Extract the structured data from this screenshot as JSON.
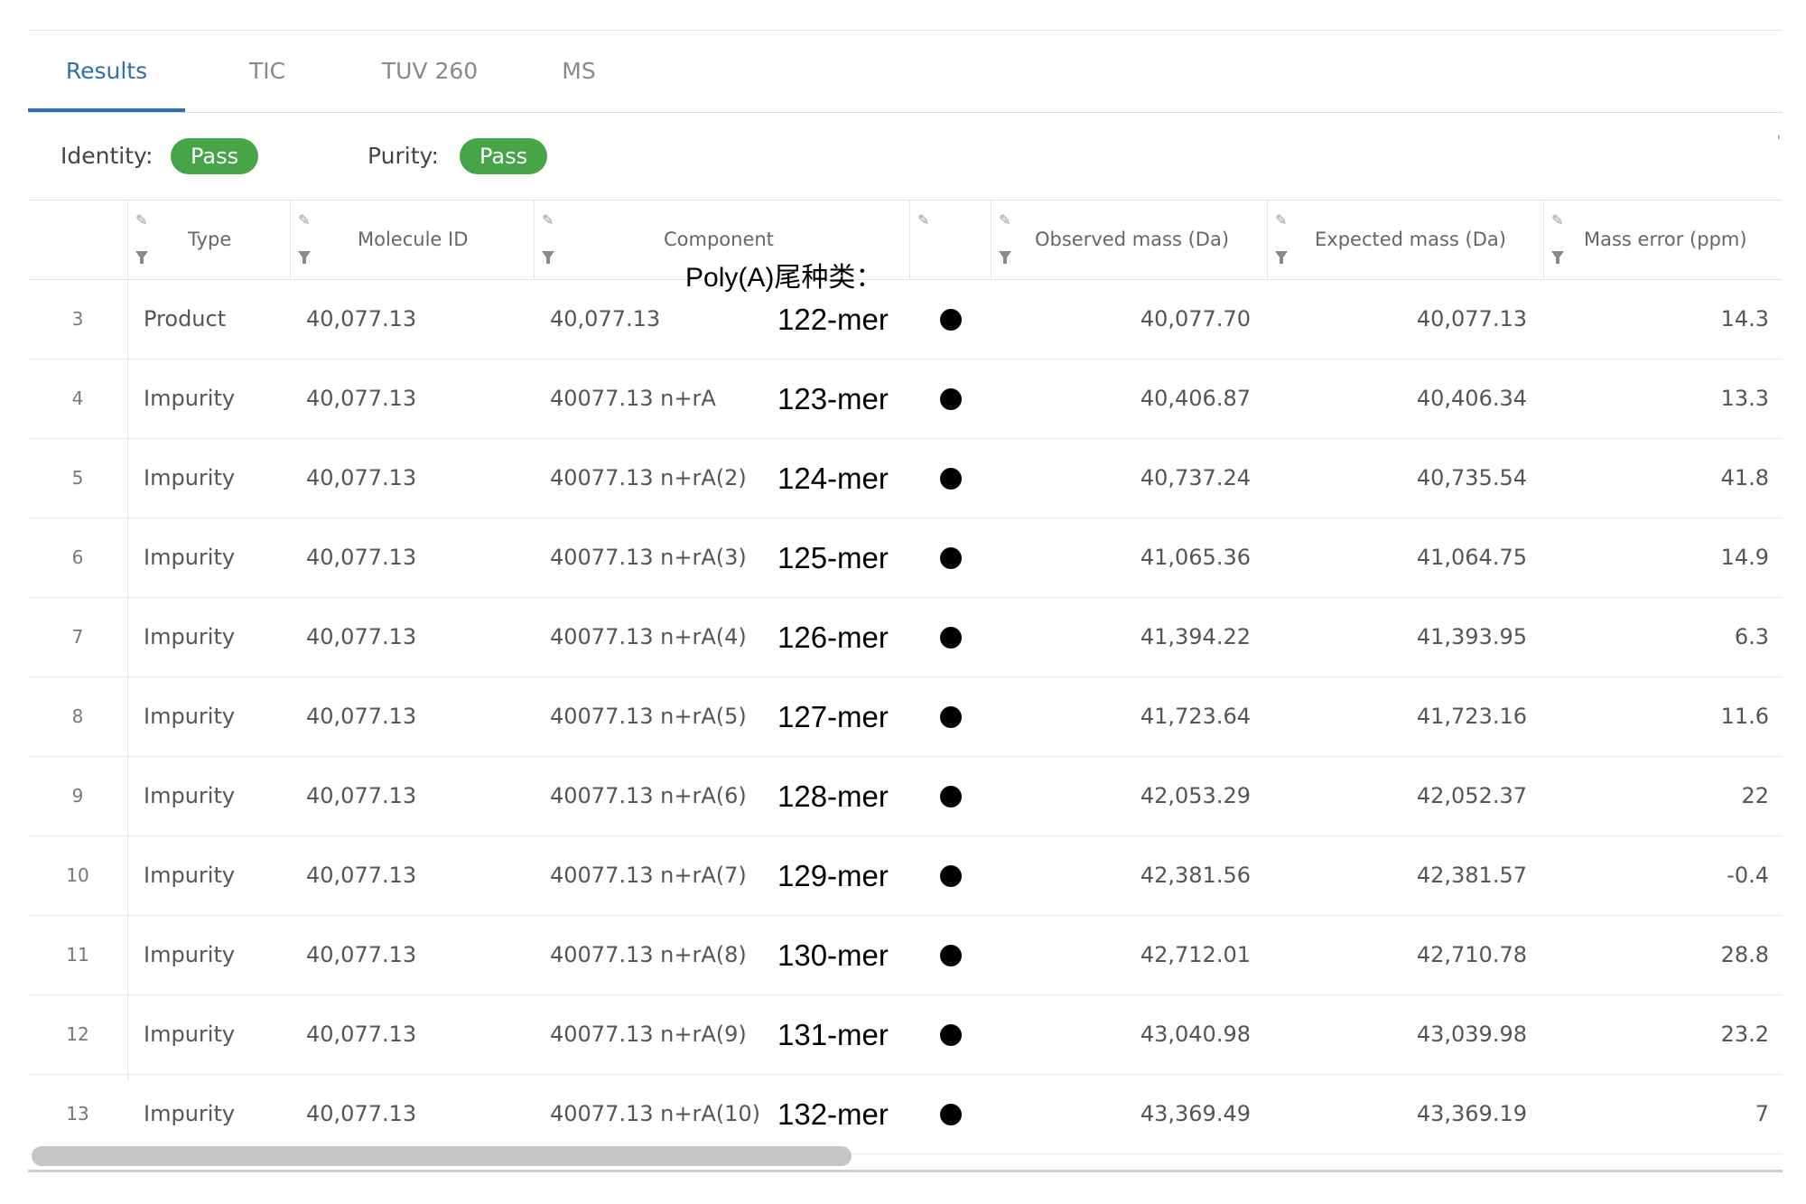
{
  "tabs": [
    {
      "label": "Results",
      "active": true
    },
    {
      "label": "TIC",
      "active": false
    },
    {
      "label": "TUV 260",
      "active": false
    },
    {
      "label": "MS",
      "active": false
    }
  ],
  "status": {
    "identity_label": "Identity:",
    "identity_value": "Pass",
    "purity_label": "Purity:",
    "purity_value": "Pass",
    "pass_color": "#47a447"
  },
  "table": {
    "headers": {
      "type": "Type",
      "molecule_id": "Molecule ID",
      "component": "Component",
      "observed_mass": "Observed mass (Da)",
      "expected_mass": "Expected mass (Da)",
      "mass_error": "Mass error (ppm)"
    },
    "annotation_header": "Poly(A)尾种类：",
    "rows": [
      {
        "num": "3",
        "type": "Product",
        "molecule_id": "40,077.13",
        "component": "40,077.13",
        "mer": "122-mer",
        "observed": "40,077.70",
        "expected": "40,077.13",
        "error": "14.3"
      },
      {
        "num": "4",
        "type": "Impurity",
        "molecule_id": "40,077.13",
        "component": "40077.13 n+rA",
        "mer": "123-mer",
        "observed": "40,406.87",
        "expected": "40,406.34",
        "error": "13.3"
      },
      {
        "num": "5",
        "type": "Impurity",
        "molecule_id": "40,077.13",
        "component": "40077.13 n+rA(2)",
        "mer": "124-mer",
        "observed": "40,737.24",
        "expected": "40,735.54",
        "error": "41.8"
      },
      {
        "num": "6",
        "type": "Impurity",
        "molecule_id": "40,077.13",
        "component": "40077.13 n+rA(3)",
        "mer": "125-mer",
        "observed": "41,065.36",
        "expected": "41,064.75",
        "error": "14.9"
      },
      {
        "num": "7",
        "type": "Impurity",
        "molecule_id": "40,077.13",
        "component": "40077.13 n+rA(4)",
        "mer": "126-mer",
        "observed": "41,394.22",
        "expected": "41,393.95",
        "error": "6.3"
      },
      {
        "num": "8",
        "type": "Impurity",
        "molecule_id": "40,077.13",
        "component": "40077.13 n+rA(5)",
        "mer": "127-mer",
        "observed": "41,723.64",
        "expected": "41,723.16",
        "error": "11.6"
      },
      {
        "num": "9",
        "type": "Impurity",
        "molecule_id": "40,077.13",
        "component": "40077.13 n+rA(6)",
        "mer": "128-mer",
        "observed": "42,053.29",
        "expected": "42,052.37",
        "error": "22"
      },
      {
        "num": "10",
        "type": "Impurity",
        "molecule_id": "40,077.13",
        "component": "40077.13 n+rA(7)",
        "mer": "129-mer",
        "observed": "42,381.56",
        "expected": "42,381.57",
        "error": "-0.4"
      },
      {
        "num": "11",
        "type": "Impurity",
        "molecule_id": "40,077.13",
        "component": "40077.13 n+rA(8)",
        "mer": "130-mer",
        "observed": "42,712.01",
        "expected": "42,710.78",
        "error": "28.8"
      },
      {
        "num": "12",
        "type": "Impurity",
        "molecule_id": "40,077.13",
        "component": "40077.13 n+rA(9)",
        "mer": "131-mer",
        "observed": "43,040.98",
        "expected": "43,039.98",
        "error": "23.2"
      },
      {
        "num": "13",
        "type": "Impurity",
        "molecule_id": "40,077.13",
        "component": "40077.13 n+rA(10)",
        "mer": "132-mer",
        "observed": "43,369.49",
        "expected": "43,369.19",
        "error": "7"
      }
    ]
  },
  "icons": {
    "pin": "pin-icon",
    "filter": "filter-icon",
    "status_dot": "status-dot-icon"
  }
}
